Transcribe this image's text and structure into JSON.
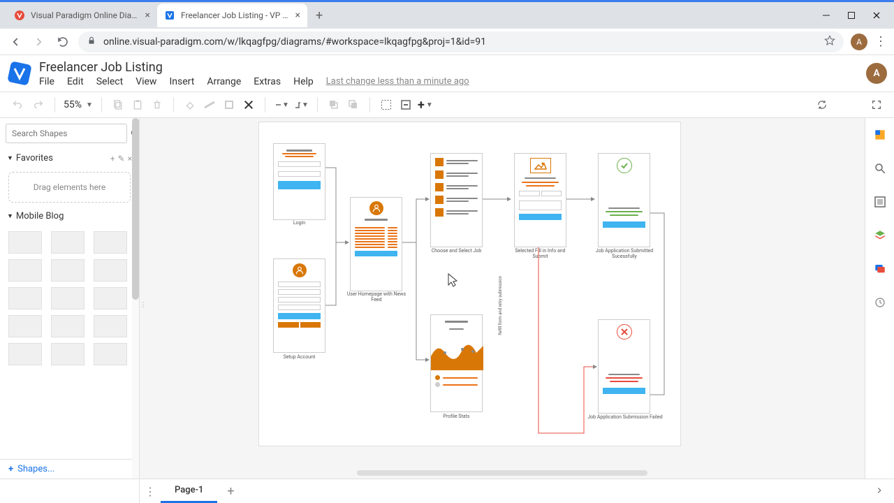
{
  "browser": {
    "tabs": [
      {
        "title": "Visual Paradigm Online Diagrams",
        "active": false
      },
      {
        "title": "Freelancer Job Listing - VP Online",
        "active": true
      }
    ],
    "url": "online.visual-paradigm.com/w/lkqagfpg/diagrams/#workspace=lkqagfpg&proj=1&id=91",
    "profile_letter": "A"
  },
  "app": {
    "title": "Freelancer Job Listing",
    "menus": [
      "File",
      "Edit",
      "Select",
      "View",
      "Insert",
      "Arrange",
      "Extras",
      "Help"
    ],
    "last_change": "Last change less than a minute ago",
    "profile_letter": "A"
  },
  "toolbar": {
    "zoom": "55%"
  },
  "sidebar": {
    "search_placeholder": "Search Shapes",
    "favorites_label": "Favorites",
    "drop_hint": "Drag elements here",
    "section_label": "Mobile Blog",
    "shapes_link": "Shapes..."
  },
  "canvas": {
    "labels": {
      "login": "Login",
      "setup": "Setup Account",
      "homepage": "User Homepage with News Feed",
      "select_job": "Choose and Select Job",
      "fill_submit": "Selected Fill in Info and Submit",
      "success": "Job Application Submitted Sucessfully",
      "failed": "Job Application Submission Failed",
      "profile_stats": "Profile Stats",
      "refill": "Refill form and retry submission"
    }
  },
  "footer": {
    "page_label": "Page-1"
  }
}
